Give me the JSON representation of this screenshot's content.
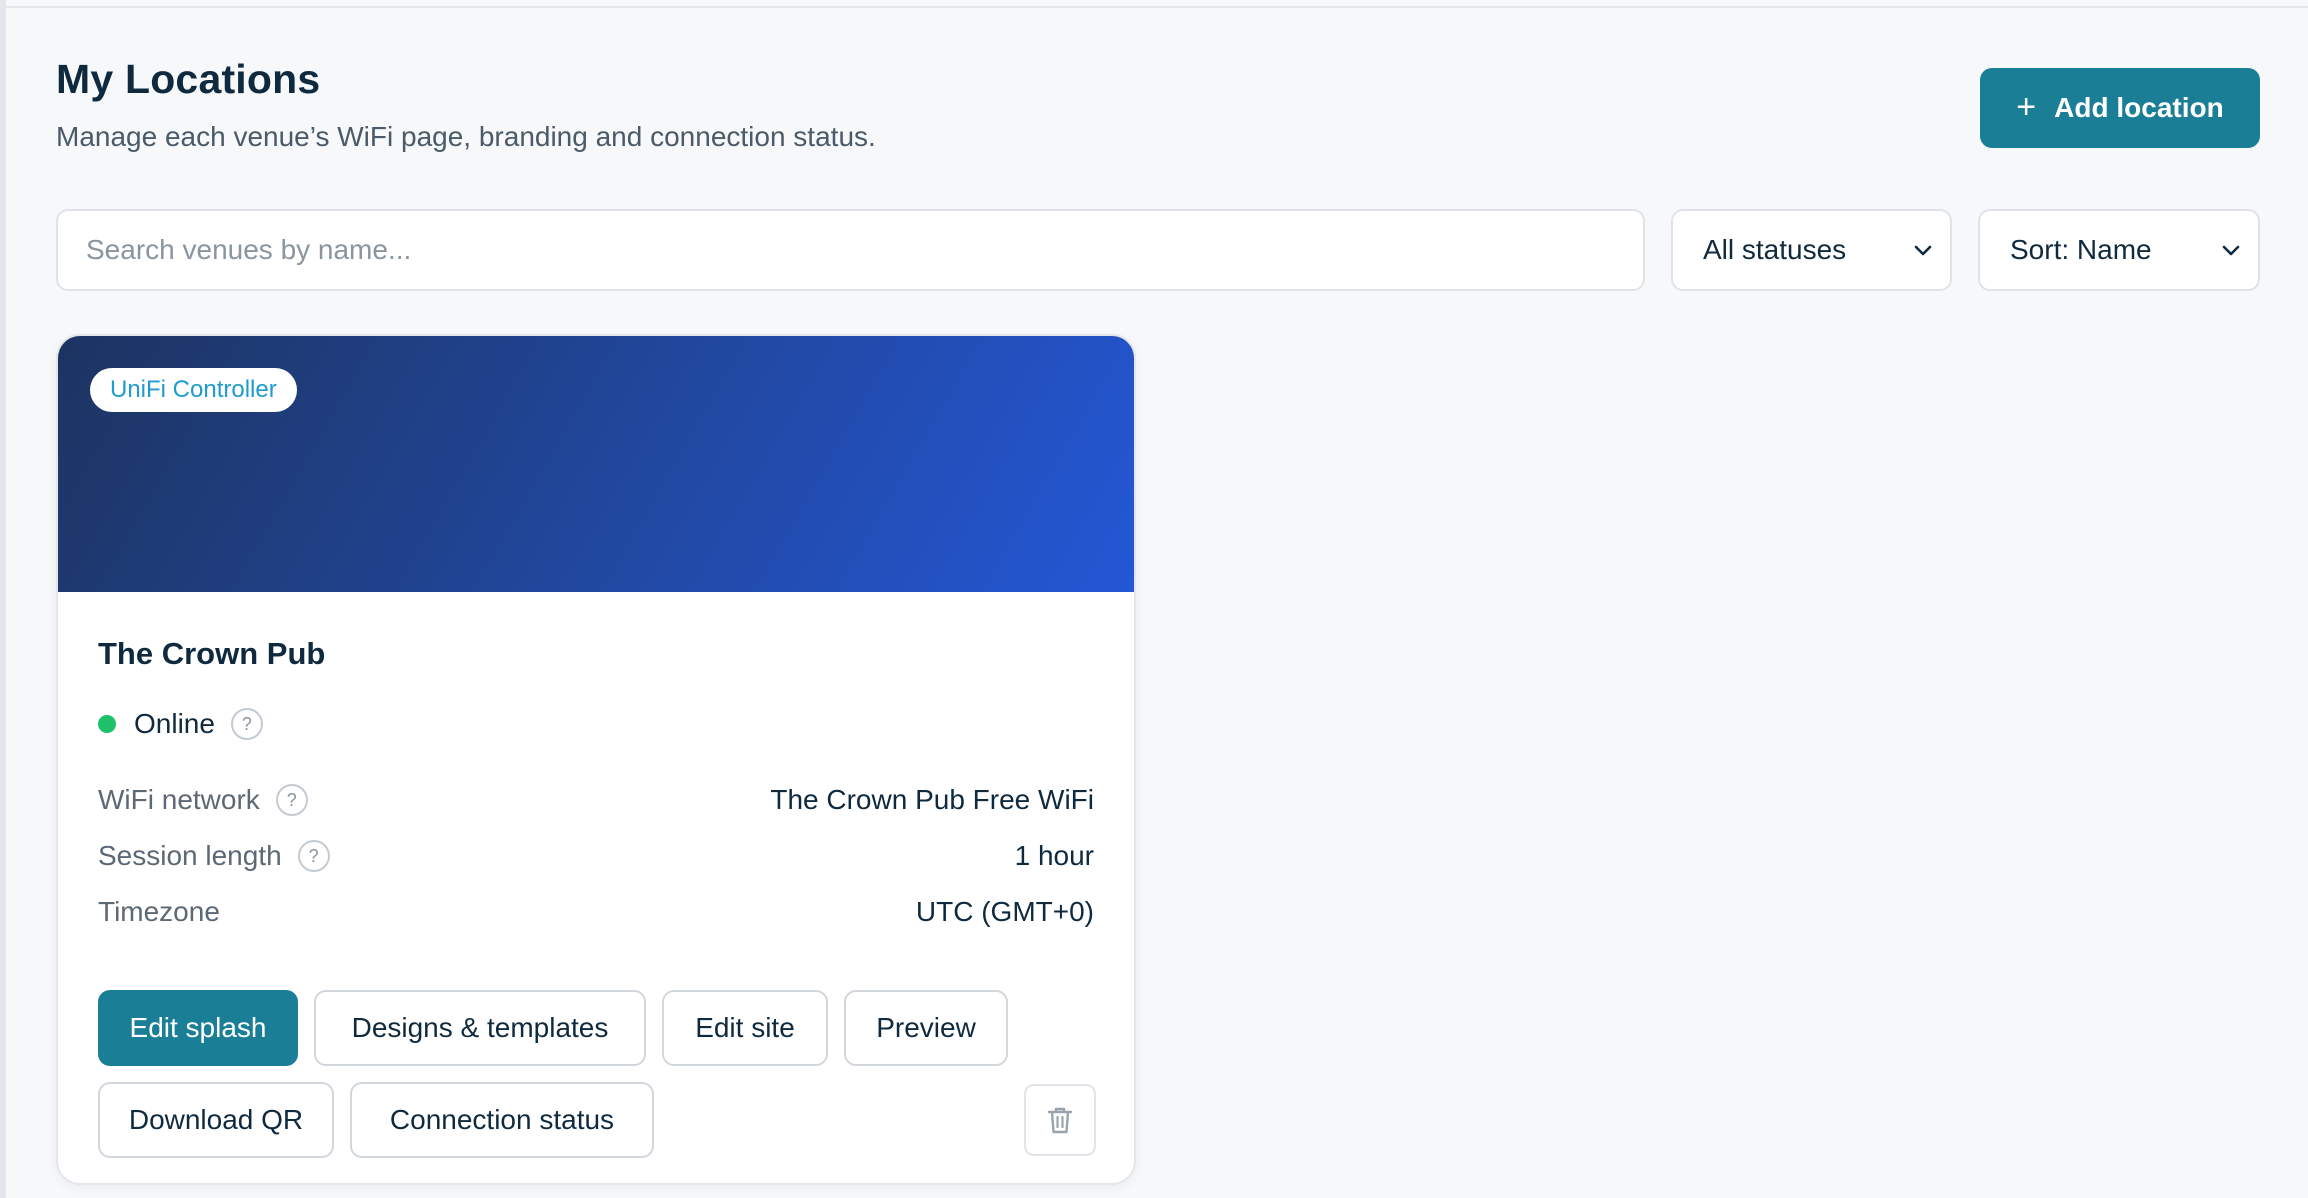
{
  "header": {
    "title": "My Locations",
    "subtitle": "Manage each venue’s WiFi page, branding and connection status.",
    "add_button_label": "Add location",
    "add_button_icon": "plus-icon"
  },
  "filters": {
    "search_placeholder": "Search venues by name...",
    "search_value": "",
    "status_select": {
      "selected": "All statuses"
    },
    "sort_select": {
      "selected": "Sort: Name"
    }
  },
  "locations": [
    {
      "provider_badge": "UniFi Controller",
      "name": "The Crown Pub",
      "status": "Online",
      "status_color": "#20c06a",
      "details": [
        {
          "label": "WiFi network",
          "value": "The Crown Pub Free WiFi"
        },
        {
          "label": "Session length",
          "value": "1 hour"
        },
        {
          "label": "Timezone",
          "value": "UTC (GMT+0)"
        }
      ],
      "actions": {
        "edit_splash": "Edit splash",
        "designs_templates": "Designs & templates",
        "edit_site": "Edit site",
        "preview": "Preview",
        "download_qr": "Download QR",
        "connection_status": "Connection status",
        "delete_icon": "trash-icon"
      }
    }
  ],
  "colors": {
    "accent": "#1a7f96",
    "banner_start": "#1d3461",
    "banner_end": "#2457d6",
    "badge_text": "#1f9bd0",
    "online": "#20c06a"
  }
}
